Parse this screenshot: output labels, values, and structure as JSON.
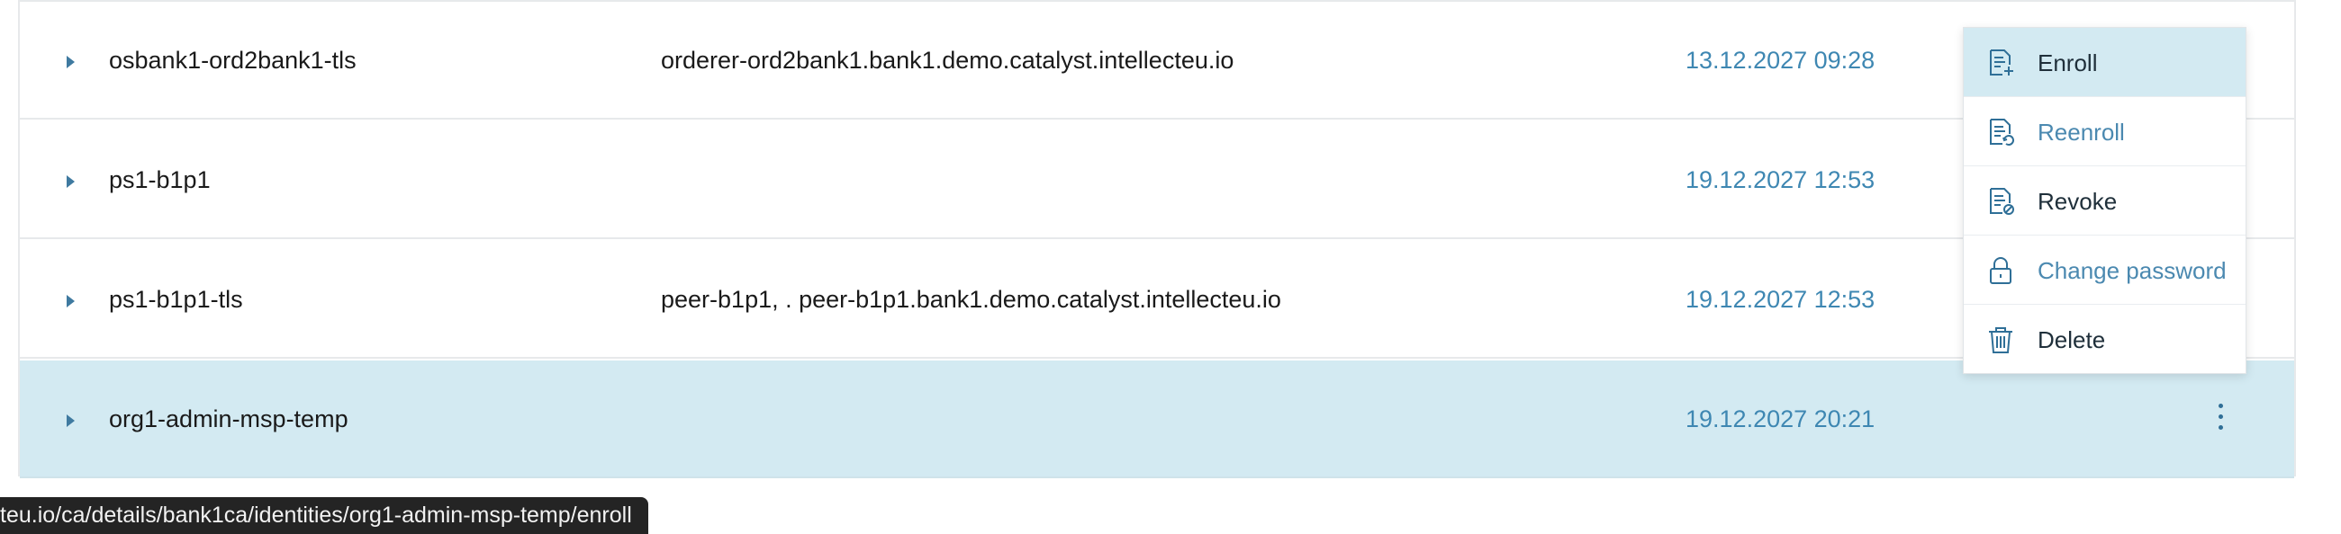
{
  "rows": [
    {
      "name": "osbank1-ord2bank1-tls",
      "hosts": "orderer-ord2bank1.bank1.demo.catalyst.intellecteu.io",
      "expires": "13.12.2027 09:28"
    },
    {
      "name": "ps1-b1p1",
      "hosts": "",
      "expires": "19.12.2027 12:53"
    },
    {
      "name": "ps1-b1p1-tls",
      "hosts": "peer-b1p1, . peer-b1p1.bank1.demo.catalyst.intellecteu.io",
      "expires": "19.12.2027 12:53"
    },
    {
      "name": "org1-admin-msp-temp",
      "hosts": "",
      "expires": "19.12.2027 20:21"
    }
  ],
  "menu": {
    "items": [
      {
        "label": "Enroll",
        "icon": "document-plus-icon"
      },
      {
        "label": "Reenroll",
        "icon": "document-refresh-icon"
      },
      {
        "label": "Revoke",
        "icon": "document-block-icon"
      },
      {
        "label": "Change password",
        "icon": "lock-icon"
      },
      {
        "label": "Delete",
        "icon": "trash-icon"
      }
    ]
  },
  "status_bar": {
    "url": "teu.io/ca/details/bank1ca/identities/org1-admin-msp-temp/enroll"
  },
  "colors": {
    "accent": "#3e87b2",
    "selected_row": "#d3eaf2",
    "border": "#e7e9eb"
  }
}
